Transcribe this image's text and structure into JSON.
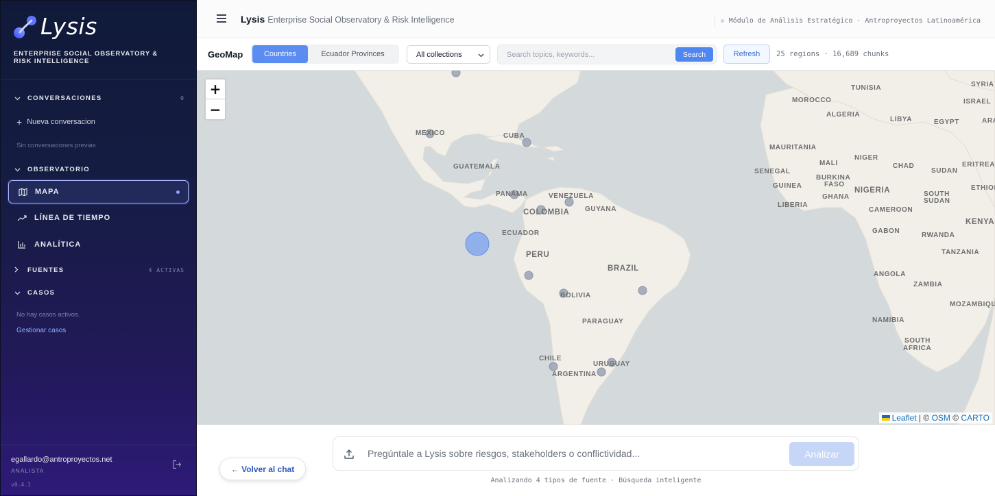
{
  "sidebar": {
    "brand": "Lysis",
    "tagline": "ENTERPRISE SOCIAL OBSERVATORY & RISK INTELLIGENCE",
    "conversaciones": {
      "title": "CONVERSACIONES",
      "count": "0",
      "new_label": "Nueva conversacion",
      "empty": "Sin conversaciones previas"
    },
    "observatorio": {
      "title": "OBSERVATORIO"
    },
    "nav": [
      {
        "label": "MAPA",
        "icon": "map-icon",
        "active": true
      },
      {
        "label": "LÍNEA DE TIEMPO",
        "icon": "trend-icon",
        "active": false
      },
      {
        "label": "ANALÍTICA",
        "icon": "bar-chart-icon",
        "active": false
      }
    ],
    "fuentes": {
      "title": "FUENTES",
      "badge": "4 ACTIVAS"
    },
    "casos": {
      "title": "CASOS",
      "empty": "No hay casos activos.",
      "manage_label": "Gestionar casos"
    },
    "user": {
      "email": "egallardo@antroproyectos.net",
      "role": "ANALISTA",
      "version": "v0.4.1"
    }
  },
  "topbar": {
    "title": "Lysis",
    "subtitle": "Enterprise Social Observatory & Risk Intelligence",
    "context": "Módulo de Análisis Estratégico · Antroproyectos Latinoamérica"
  },
  "toolbar": {
    "label": "GeoMap",
    "tabs": [
      {
        "label": "Countries",
        "active": true
      },
      {
        "label": "Ecuador Provinces",
        "active": false
      }
    ],
    "collection": "All collections",
    "search_placeholder": "Search topics, keywords...",
    "search_label": "Search",
    "refresh_label": "Refresh",
    "stats": "25 regions · 16,689 chunks"
  },
  "map": {
    "zoom_in": "+",
    "zoom_out": "−",
    "labels": {
      "mexico": "MEXICO",
      "cuba": "CUBA",
      "guatemala": "GUATEMALA",
      "panama": "PANAMA",
      "venezuela": "VENEZUELA",
      "guyana": "GUYANA",
      "colombia": "COLOMBIA",
      "ecuador": "ECUADOR",
      "peru": "PERU",
      "brazil": "BRAZIL",
      "bolivia": "BOLIVIA",
      "paraguay": "PARAGUAY",
      "chile": "CHILE",
      "uruguay": "URUGUAY",
      "argentina": "ARGENTINA",
      "morocco": "MOROCCO",
      "tunisia": "TUNISIA",
      "algeria": "ALGERIA",
      "libya": "LIBYA",
      "egypt": "EGYPT",
      "syria": "SYRIA",
      "israel": "ISRAEL",
      "ara": "ARA",
      "mauritania": "MAURITANIA",
      "mali": "MALI",
      "niger": "NIGER",
      "chad": "CHAD",
      "sudan": "SUDAN",
      "eritrea": "ERITREA",
      "senegal": "SENEGAL",
      "guinea": "GUINEA",
      "burkina": "BURKINA",
      "faso": "FASO",
      "nigeria": "NIGERIA",
      "ethiopia": "ETHIOPI",
      "ghana": "GHANA",
      "liberia": "LIBERIA",
      "south_sudan_1": "SOUTH",
      "south_sudan_2": "SUDAN",
      "cameroon": "CAMEROON",
      "kenya": "KENYA",
      "gabon": "GABON",
      "rwanda": "RWANDA",
      "tanzania": "TANZANIA",
      "angola": "ANGOLA",
      "zambia": "ZAMBIA",
      "mozambique": "MOZAMBIQUE",
      "namibia": "NAMIBIA",
      "south_africa_1": "SOUTH",
      "south_africa_2": "AFRICA"
    },
    "attribution": {
      "leaflet": "Leaflet",
      "sep1": " | © ",
      "osm": "OSM",
      "sep2": " © ",
      "carto": "CARTO"
    },
    "colors": {
      "water": "#d4dadc",
      "land": "#f2efe9",
      "marker": "#9aa3b4",
      "highlight": "#7aa0f0"
    }
  },
  "composer": {
    "placeholder": "Pregúntale a Lysis sobre riesgos, stakeholders o conflictividad...",
    "submit_label": "Analizar",
    "back_label": "← Volver al chat",
    "footnote": "Analizando 4 tipos de fuente · Búsqueda inteligente"
  }
}
